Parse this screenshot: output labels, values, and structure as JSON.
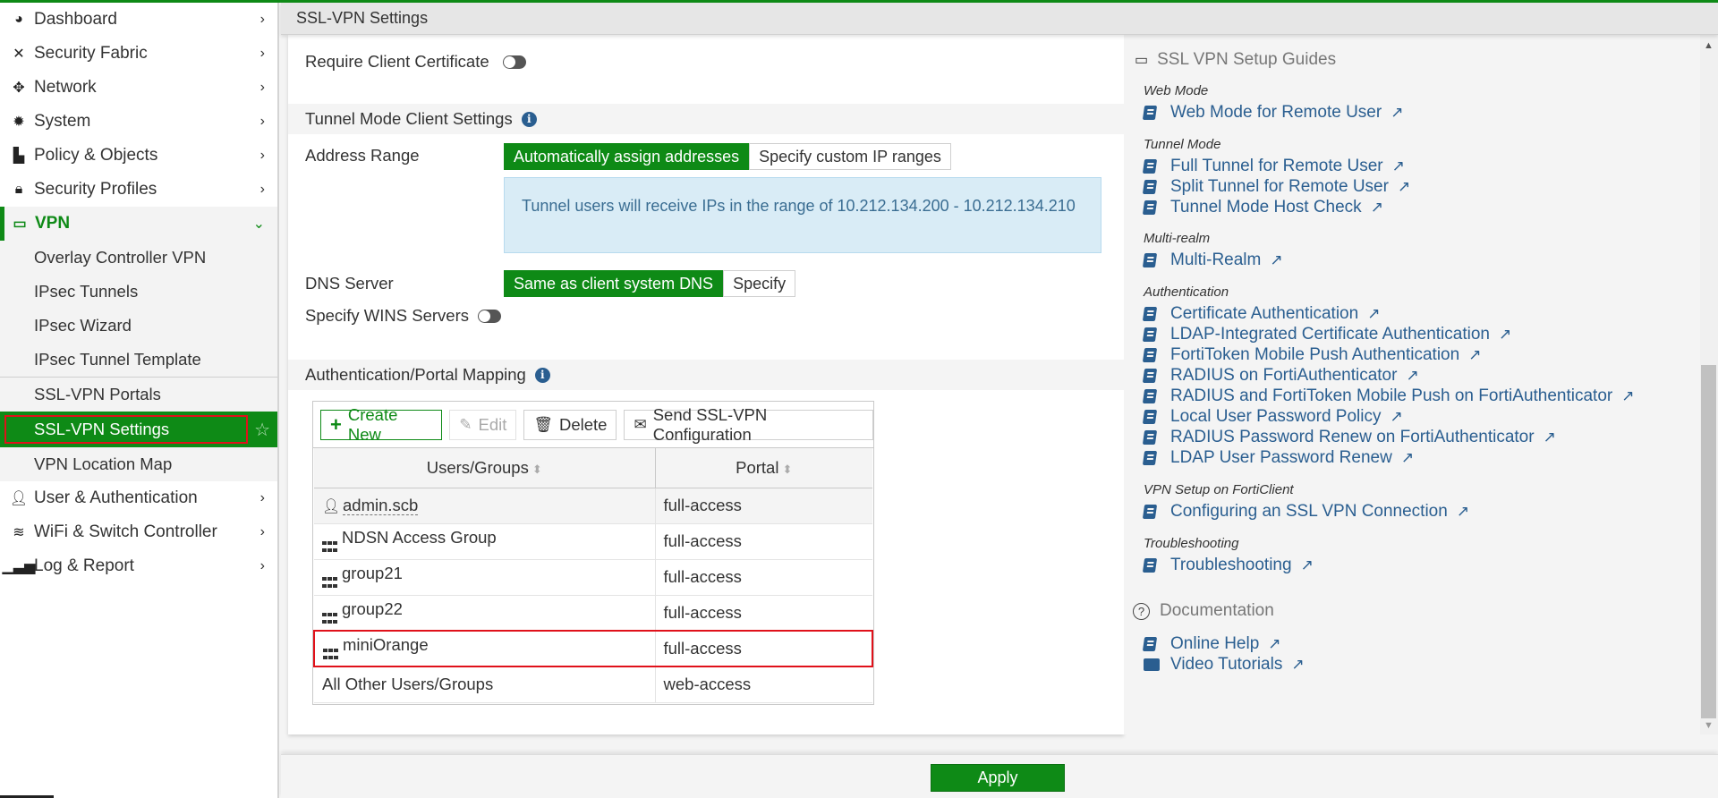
{
  "header": {
    "title": "SSL-VPN Settings"
  },
  "sidebar": {
    "items": [
      {
        "label": "Dashboard",
        "icon": "dashboard-icon"
      },
      {
        "label": "Security Fabric",
        "icon": "security-fabric-icon"
      },
      {
        "label": "Network",
        "icon": "network-icon"
      },
      {
        "label": "System",
        "icon": "gear-icon"
      },
      {
        "label": "Policy & Objects",
        "icon": "policy-icon"
      },
      {
        "label": "Security Profiles",
        "icon": "lock-icon"
      },
      {
        "label": "VPN",
        "icon": "laptop-icon",
        "expanded": true
      },
      {
        "label": "User & Authentication",
        "icon": "user-icon"
      },
      {
        "label": "WiFi & Switch Controller",
        "icon": "wifi-icon"
      },
      {
        "label": "Log & Report",
        "icon": "bar-chart-icon"
      }
    ],
    "vpn_subitems": [
      "Overlay Controller VPN",
      "IPsec Tunnels",
      "IPsec Wizard",
      "IPsec Tunnel Template",
      "SSL-VPN Portals",
      "SSL-VPN Settings",
      "VPN Location Map"
    ],
    "selected": "SSL-VPN Settings"
  },
  "main": {
    "require_client_cert_label": "Require Client Certificate",
    "require_client_cert": false,
    "tunnel_section_title": "Tunnel Mode Client Settings",
    "address_range_label": "Address Range",
    "address_range_options": [
      "Automatically assign addresses",
      "Specify custom IP ranges"
    ],
    "address_range_selected": "Automatically assign addresses",
    "range_info": "Tunnel users will receive IPs in the range of 10.212.134.200 - 10.212.134.210",
    "dns_label": "DNS Server",
    "dns_options": [
      "Same as client system DNS",
      "Specify"
    ],
    "dns_selected": "Same as client system DNS",
    "wins_label": "Specify WINS Servers",
    "wins_enabled": false,
    "auth_section_title": "Authentication/Portal Mapping",
    "toolbar": {
      "create": "Create New",
      "edit": "Edit",
      "delete": "Delete",
      "send": "Send SSL-VPN Configuration"
    },
    "table": {
      "columns": [
        "Users/Groups",
        "Portal"
      ],
      "rows": [
        {
          "name": "admin.scb",
          "type": "user",
          "portal": "full-access"
        },
        {
          "name": "NDSN Access Group",
          "type": "group",
          "portal": "full-access"
        },
        {
          "name": "group21",
          "type": "group",
          "portal": "full-access"
        },
        {
          "name": "group22",
          "type": "group",
          "portal": "full-access"
        },
        {
          "name": "miniOrange",
          "type": "group",
          "portal": "full-access",
          "highlighted": true
        },
        {
          "name": "All Other Users/Groups",
          "type": "none",
          "portal": "web-access"
        }
      ]
    }
  },
  "guides": {
    "title": "SSL VPN Setup Guides",
    "categories": [
      {
        "name": "Web Mode",
        "links": [
          "Web Mode for Remote User"
        ]
      },
      {
        "name": "Tunnel Mode",
        "links": [
          "Full Tunnel for Remote User",
          "Split Tunnel for Remote User",
          "Tunnel Mode Host Check"
        ]
      },
      {
        "name": "Multi-realm",
        "links": [
          "Multi-Realm"
        ]
      },
      {
        "name": "Authentication",
        "links": [
          "Certificate Authentication",
          "LDAP-Integrated Certificate Authentication",
          "FortiToken Mobile Push Authentication",
          "RADIUS on FortiAuthenticator",
          "RADIUS and FortiToken Mobile Push on FortiAuthenticator",
          "Local User Password Policy",
          "RADIUS Password Renew on FortiAuthenticator",
          "LDAP User Password Renew"
        ]
      },
      {
        "name": "VPN Setup on FortiClient",
        "links": [
          "Configuring an SSL VPN Connection"
        ]
      },
      {
        "name": "Troubleshooting",
        "links": [
          "Troubleshooting"
        ]
      }
    ],
    "documentation_title": "Documentation",
    "documentation_links": [
      "Online Help",
      "Video Tutorials"
    ]
  },
  "footer": {
    "apply_label": "Apply"
  },
  "colors": {
    "accent": "#0e8a16",
    "link": "#2a5e90",
    "highlight": "#e0111a",
    "info_bg": "#d9ecf6"
  }
}
